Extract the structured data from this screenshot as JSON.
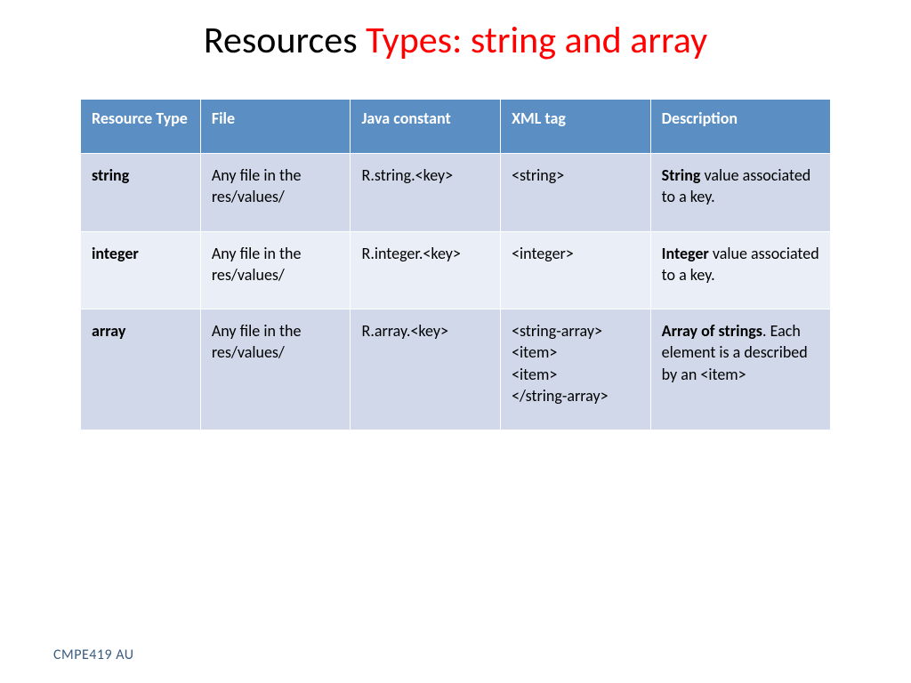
{
  "title": {
    "part1": "Resources ",
    "part2": "Types: string and array"
  },
  "table": {
    "headers": [
      "Resource Type",
      "File",
      "Java constant",
      "XML tag",
      "Description"
    ],
    "rows": [
      {
        "type": "string",
        "file": "Any file in the res/values/",
        "constant": "R.string.<key>",
        "xml": "<string>",
        "desc_bold": "String",
        "desc_rest": " value associated to a key."
      },
      {
        "type": "integer",
        "file": "Any file in the res/values/",
        "constant": "R.integer.<key>",
        "xml": "<integer>",
        "desc_bold": "Integer",
        "desc_rest": " value associated to a key."
      },
      {
        "type": "array",
        "file": "Any file in the res/values/",
        "constant": "R.array.<key>",
        "xml": "<string-array>\n<item>\n<item>\n</string-array>",
        "desc_bold": "Array of strings",
        "desc_rest": ". Each element is a described by an <item>"
      }
    ]
  },
  "footer": "CMPE419 AU"
}
